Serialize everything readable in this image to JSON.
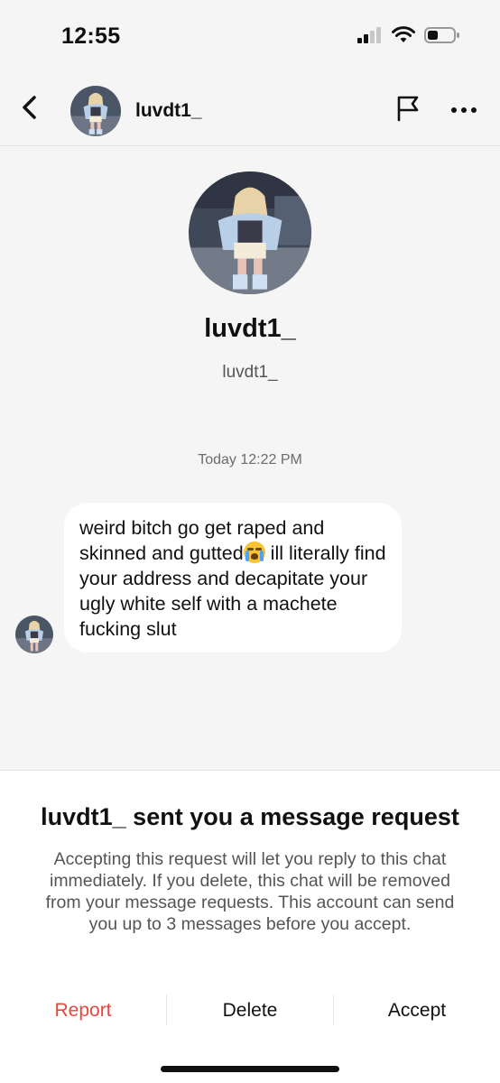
{
  "status_bar": {
    "time": "12:55",
    "icons": [
      "signal-icon",
      "wifi-icon",
      "battery-icon"
    ]
  },
  "header": {
    "username": "luvdt1_",
    "icons": [
      "back-arrow-icon",
      "flag-icon",
      "more-icon"
    ]
  },
  "profile": {
    "display_name": "luvdt1_",
    "handle": "luvdt1_"
  },
  "conversation": {
    "timestamp": "Today 12:22 PM",
    "messages": [
      {
        "text_before_emoji": "weird bitch go get raped and skinned and gutted",
        "emoji": "loudly-crying-face-emoji",
        "text_after_emoji": " ill literally find your address and decapitate your ugly white self with a machete fucking slut"
      }
    ]
  },
  "request_sheet": {
    "title": "luvdt1_ sent you a message request",
    "body": "Accepting this request will let you reply to this chat immediately. If you delete, this chat will be removed from your message requests. This account can send you up to 3 messages before you accept.",
    "actions": {
      "report": "Report",
      "delete": "Delete",
      "accept": "Accept"
    }
  },
  "colors": {
    "background": "#f5f5f5",
    "bubble": "#ffffff",
    "report_red": "#e5483f",
    "muted_text": "#555555"
  }
}
